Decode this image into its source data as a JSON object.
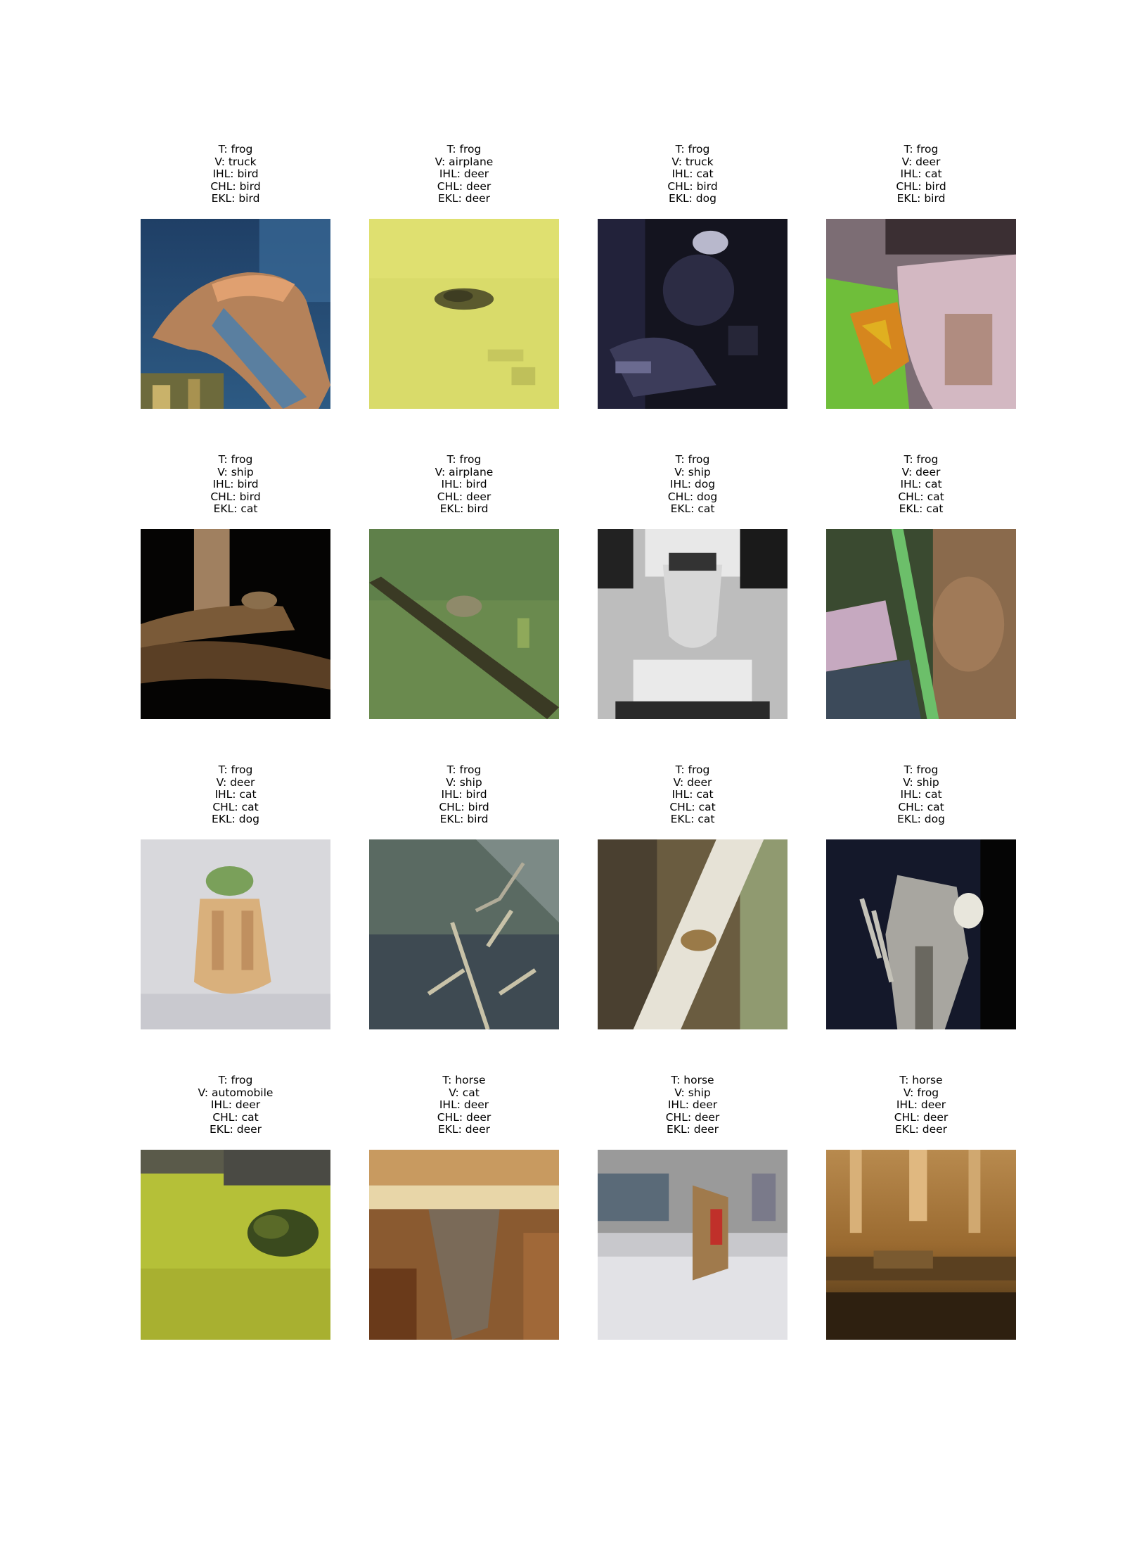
{
  "grid": [
    {
      "t": "T: frog",
      "v": "V: truck",
      "ihl": "IHL: bird",
      "chl": "CHL: bird",
      "ekl": "EKL: bird",
      "subject": "bird perched, blue background"
    },
    {
      "t": "T: frog",
      "v": "V: airplane",
      "ihl": "IHL: deer",
      "chl": "CHL: deer",
      "ekl": "EKL: deer",
      "subject": "small dark creature on yellow-green ground"
    },
    {
      "t": "T: frog",
      "v": "V: truck",
      "ihl": "IHL: cat",
      "chl": "CHL: bird",
      "ekl": "EKL: dog",
      "subject": "dark blurry scene"
    },
    {
      "t": "T: frog",
      "v": "V: deer",
      "ihl": "IHL: cat",
      "chl": "CHL: bird",
      "ekl": "EKL: bird",
      "subject": "orange frog on green leaf with pink rock"
    },
    {
      "t": "T: frog",
      "v": "V: ship",
      "ihl": "IHL: bird",
      "chl": "CHL: bird",
      "ekl": "EKL: cat",
      "subject": "frog on branch, black background"
    },
    {
      "t": "T: frog",
      "v": "V: airplane",
      "ihl": "IHL: bird",
      "chl": "CHL: deer",
      "ekl": "EKL: bird",
      "subject": "frog on diagonal stem, green background"
    },
    {
      "t": "T: frog",
      "v": "V: ship",
      "ihl": "IHL: dog",
      "chl": "CHL: dog",
      "ekl": "EKL: cat",
      "subject": "grayscale frog"
    },
    {
      "t": "T: frog",
      "v": "V: deer",
      "ihl": "IHL: cat",
      "chl": "CHL: cat",
      "ekl": "EKL: cat",
      "subject": "frog behind green stem"
    },
    {
      "t": "T: frog",
      "v": "V: deer",
      "ihl": "IHL: cat",
      "chl": "CHL: cat",
      "ekl": "EKL: dog",
      "subject": "frog figurine on light background"
    },
    {
      "t": "T: frog",
      "v": "V: ship",
      "ihl": "IHL: bird",
      "chl": "CHL: bird",
      "ekl": "EKL: bird",
      "subject": "gray water with twigs"
    },
    {
      "t": "T: frog",
      "v": "V: deer",
      "ihl": "IHL: cat",
      "chl": "CHL: cat",
      "ekl": "EKL: cat",
      "subject": "small frog on pale diagonal band"
    },
    {
      "t": "T: frog",
      "v": "V: ship",
      "ihl": "IHL: cat",
      "chl": "CHL: cat",
      "ekl": "EKL: dog",
      "subject": "pale frog on dark background"
    },
    {
      "t": "T: frog",
      "v": "V: automobile",
      "ihl": "IHL: deer",
      "chl": "CHL: cat",
      "ekl": "EKL: deer",
      "subject": "frog on yellow-green grass"
    },
    {
      "t": "T: horse",
      "v": "V: cat",
      "ihl": "IHL: deer",
      "chl": "CHL: deer",
      "ekl": "EKL: deer",
      "subject": "horse head close-up, brown tones"
    },
    {
      "t": "T: horse",
      "v": "V: ship",
      "ihl": "IHL: deer",
      "chl": "CHL: deer",
      "ekl": "EKL: deer",
      "subject": "horse and rider, light background"
    },
    {
      "t": "T: horse",
      "v": "V: frog",
      "ihl": "IHL: deer",
      "chl": "CHL: deer",
      "ekl": "EKL: deer",
      "subject": "brown blurry field scene"
    }
  ]
}
